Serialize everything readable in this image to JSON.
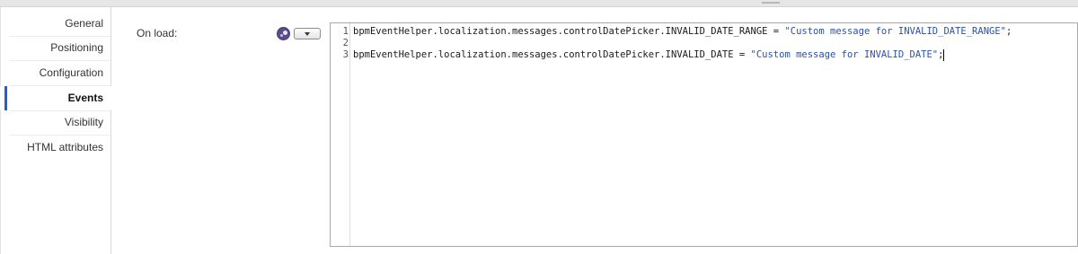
{
  "tabs": [
    {
      "label": "General",
      "active": false
    },
    {
      "label": "Positioning",
      "active": false
    },
    {
      "label": "Configuration",
      "active": false
    },
    {
      "label": "Events",
      "active": true
    },
    {
      "label": "Visibility",
      "active": false
    },
    {
      "label": "HTML attributes",
      "active": false
    }
  ],
  "event": {
    "label": "On load:",
    "palette_icon": "palette-icon",
    "dropdown_icon": "chevron-down-icon"
  },
  "editor": {
    "lines": [
      {
        "number": "1",
        "code": "bpmEventHelper.localization.messages.controlDatePicker.INVALID_DATE_RANGE = ",
        "string": "\"Custom message for INVALID_DATE_RANGE\"",
        "end": ";"
      },
      {
        "number": "2",
        "code": "",
        "string": "",
        "end": ""
      },
      {
        "number": "3",
        "code": "bpmEventHelper.localization.messages.controlDatePicker.INVALID_DATE = ",
        "string": "\"Custom message for INVALID_DATE\"",
        "end": ";"
      }
    ]
  },
  "colors": {
    "active_tab_indicator": "#1f5fcf",
    "string_literal": "#2a52a8",
    "palette_button": "#5a4b8c"
  }
}
